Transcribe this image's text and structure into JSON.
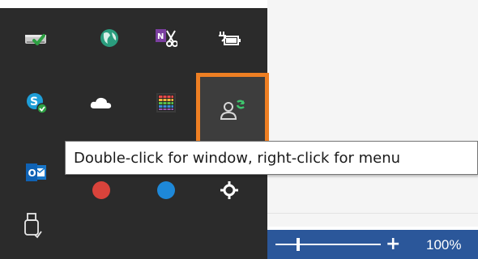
{
  "tray": {
    "icons": [
      {
        "name": "network-drive-icon"
      },
      {
        "name": "globe-sync-icon"
      },
      {
        "name": "onenote-clipper-icon"
      },
      {
        "name": "battery-icon"
      },
      {
        "name": "skype-icon"
      },
      {
        "name": "onedrive-icon"
      },
      {
        "name": "color-grid-app-icon"
      },
      {
        "name": "user-sync-icon",
        "selected": true
      },
      {
        "name": "outlook-icon"
      },
      {
        "name": "usb-eject-icon"
      }
    ],
    "selected_outline_color": "#ee7f23"
  },
  "tooltip": {
    "text": "Double-click for window, right-click for menu"
  },
  "statusbar": {
    "zoom_in_label": "+",
    "zoom_level": "100%",
    "zoom_fraction": 0.2,
    "background_color": "#2b579a"
  }
}
